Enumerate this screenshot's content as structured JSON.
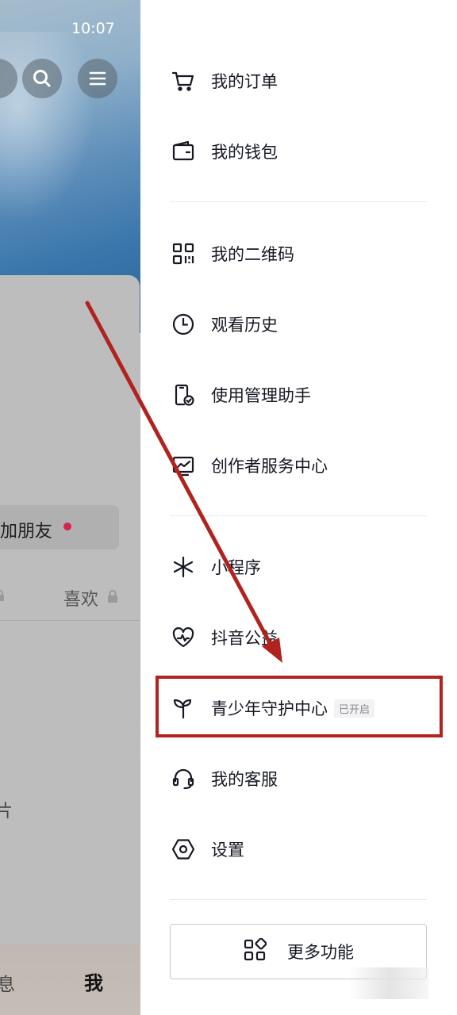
{
  "status_bar": {
    "time": "10:07"
  },
  "profile_background": {
    "add_friends_label": "加朋友",
    "likes_tab": "喜欢",
    "partial_text": "片",
    "bottom_nav": {
      "messages": "息",
      "me": "我"
    }
  },
  "drawer": {
    "items": [
      {
        "label": "我的订单",
        "icon": "cart-icon"
      },
      {
        "label": "我的钱包",
        "icon": "wallet-icon"
      },
      {
        "label": "我的二维码",
        "icon": "qrcode-icon"
      },
      {
        "label": "观看历史",
        "icon": "clock-icon"
      },
      {
        "label": "使用管理助手",
        "icon": "phone-check-icon"
      },
      {
        "label": "创作者服务中心",
        "icon": "chart-icon"
      },
      {
        "label": "小程序",
        "icon": "sparkle-icon"
      },
      {
        "label": "抖音公益",
        "icon": "heart-pulse-icon"
      },
      {
        "label": "青少年守护中心",
        "icon": "sprout-icon",
        "badge": "已开启"
      },
      {
        "label": "我的客服",
        "icon": "headset-icon"
      },
      {
        "label": "设置",
        "icon": "hexagon-settings-icon"
      }
    ],
    "more_button": {
      "label": "更多功能",
      "icon": "grid-icon"
    }
  },
  "annotation": {
    "arrow_color": "#b0231f",
    "box_color": "#b0231f"
  }
}
